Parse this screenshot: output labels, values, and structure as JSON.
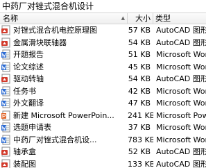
{
  "window": {
    "title": "中药厂对锉式混合机设计"
  },
  "header": {
    "name_label": "名称",
    "size_label": "大小",
    "type_label": "类型",
    "sort_indicator": "▲"
  },
  "files": [
    {
      "name": "对锉式混合机电控原理图",
      "size": "57 KB",
      "type": "AutoCAD 图形",
      "icon": "dwg-file-icon"
    },
    {
      "name": "金属滑块联轴器",
      "size": "54 KB",
      "type": "AutoCAD 图形",
      "icon": "dwg-file-icon"
    },
    {
      "name": "开题报告",
      "size": "51 KB",
      "type": "Microsoft Word",
      "icon": "word-doc-icon"
    },
    {
      "name": "论文综述",
      "size": "45 KB",
      "type": "Microsoft Word",
      "icon": "word-doc-icon"
    },
    {
      "name": "驱动转轴",
      "size": "54 KB",
      "type": "AutoCAD 图形",
      "icon": "dwg-file-icon"
    },
    {
      "name": "任务书",
      "size": "42 KB",
      "type": "Microsoft Word",
      "icon": "word-doc-icon"
    },
    {
      "name": "外文翻译",
      "size": "47 KB",
      "type": "Microsoft Word",
      "icon": "word-doc-icon"
    },
    {
      "name": "新建 Microsoft PowerPoin...",
      "size": "241 KB",
      "type": "Microsoft Powe",
      "icon": "powerpoint-file-icon"
    },
    {
      "name": "选题申请表",
      "size": "37 KB",
      "type": "Microsoft Word",
      "icon": "word-doc-icon"
    },
    {
      "name": "中药厂对锉式混合机设...",
      "size": "783 KB",
      "type": "Microsoft Word",
      "icon": "word-doc-icon"
    },
    {
      "name": "轴承盒",
      "size": "52 KB",
      "type": "AutoCAD 图形",
      "icon": "dwg-file-icon"
    },
    {
      "name": "装配图",
      "size": "133 KB",
      "type": "AutoCAD 图形",
      "icon": "dwg-file-icon"
    }
  ],
  "colors": {
    "dwg_icon_red": "#d23b2c",
    "word_icon_blue": "#2b6bd4",
    "ppt_icon_orange": "#e2672c"
  }
}
